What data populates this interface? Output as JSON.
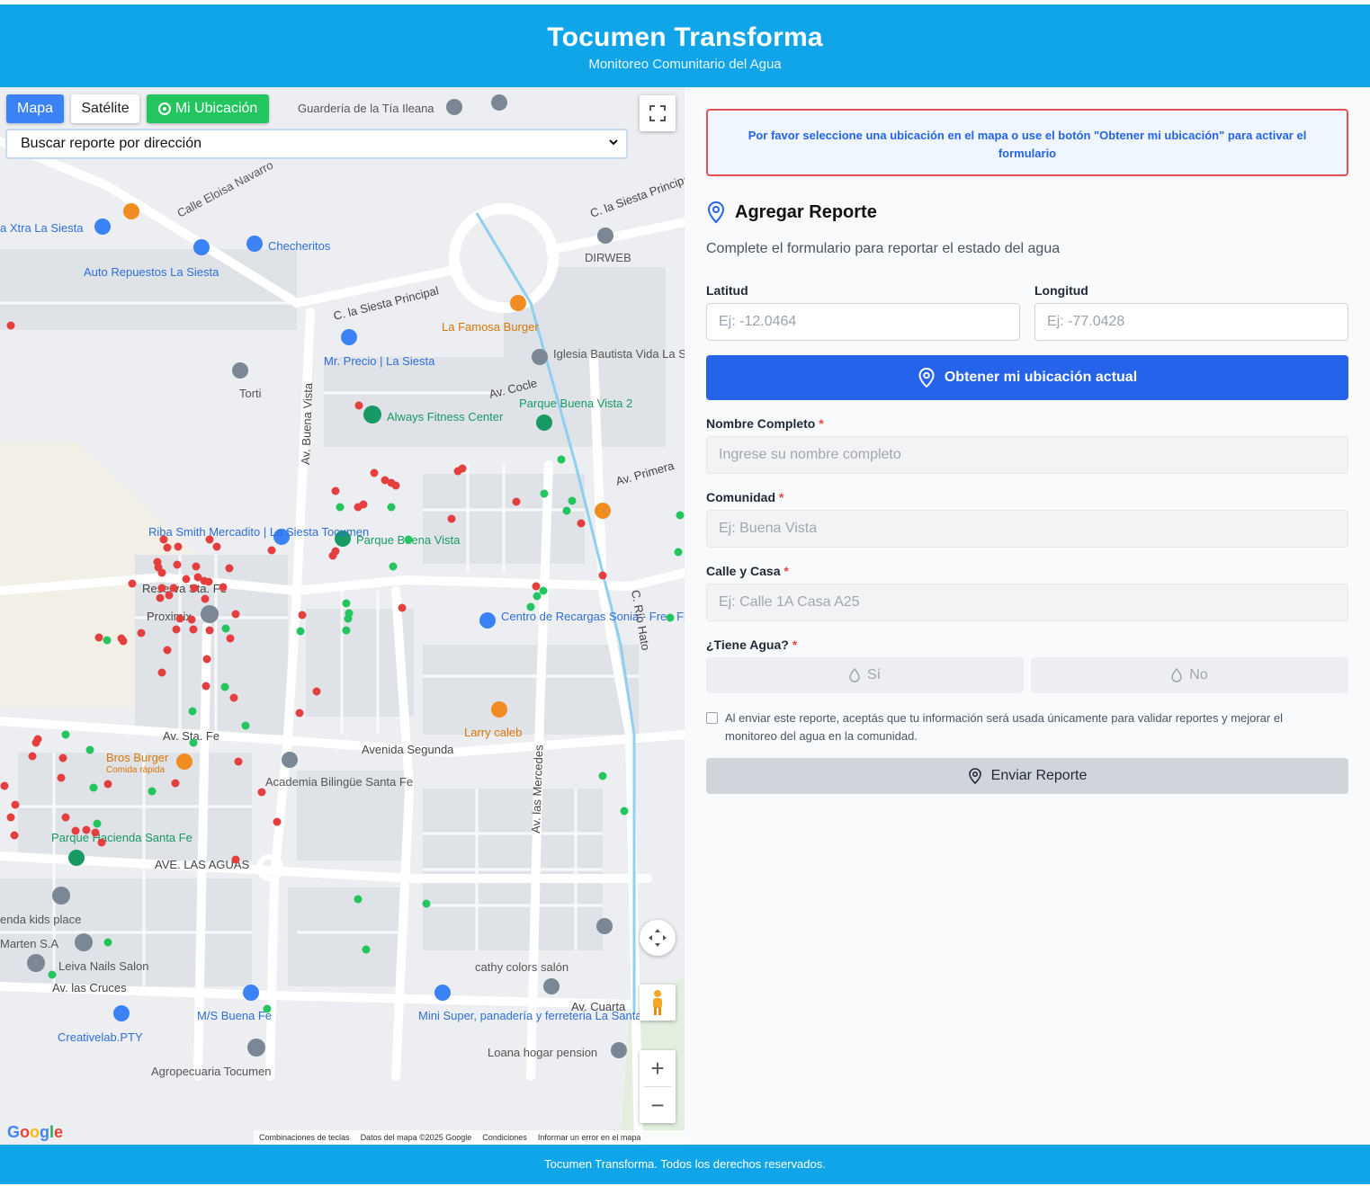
{
  "header": {
    "title": "Tocumen Transforma",
    "subtitle": "Monitoreo Comunitario del Agua"
  },
  "map": {
    "type_buttons": {
      "map": "Mapa",
      "satellite": "Satélite"
    },
    "my_location_button": "Mi Ubicación",
    "search_select": {
      "selected": "Buscar reporte por dirección"
    },
    "labels": {
      "guarderia": "Guardería de la Tía Ileana",
      "eloisa": "Calle Eloisa Navarro",
      "xtra": "a Xtra La Siesta",
      "checheritos": "Checheritos",
      "auto_repuestos": "Auto Repuestos La Siesta",
      "siesta_principal": "C. la Siesta Principal",
      "siesta_principal_2": "C. la Siesta Principal",
      "la_famosa": "La Famosa Burger",
      "dirweb": "DIRWEB",
      "iglesia": "Iglesia Bautista Vida La Siesta",
      "mr_precio": "Mr. Precio | La Siesta",
      "torti": "Torti",
      "always_fitness": "Always Fitness Center",
      "parque_bv2": "Parque Buena Vista 2",
      "av_cocle": "Av. Cocle",
      "av_primera": "Av. Primera",
      "riba_smith": "Riba Smith Mercadito | La Siesta Tocumen",
      "parque_bv": "Parque Buena Vista",
      "reserva": "Reserva Sta. Fe",
      "proximix": "Proximix",
      "centro_recargas": "Centro de Recargas Sonia - Free Fire",
      "av_sta_fe": "Av. Sta. Fe",
      "avenida_segunda": "Avenida Segunda",
      "larry": "Larry caleb",
      "bros_burger": "Bros Burger",
      "comida_rapida": "Comida rápida",
      "academia": "Academia Bilingüe Santa Fe",
      "parque_hacienda": "Parque Hacienda Santa Fe",
      "ave_las_aguas": "AVE. LAS AGUAS",
      "hacienda_kids": "enda kids place",
      "marten": "Marten S.A",
      "leiva": "Leiva Nails Salon",
      "av_las_cruces": "Av. las Cruces",
      "ms_buena_fe": "M/S Buena Fe",
      "creativelab": "Creativelab.PTY",
      "agropecuaria": "Agropecuaria Tocumen",
      "mini_super": "Mini Super, panadería y ferreteria La Santa Fe",
      "loana": "Loana hogar pension",
      "cathy": "cathy colors salón",
      "av_cuarta": "Av. Cuarta",
      "av_mercedes": "Av. las Mercedes",
      "av_buena_vista": "Av. Buena Vista",
      "c_rio_hato": "C. Río Hato"
    },
    "attribution": {
      "shortcuts": "Combinaciones de teclas",
      "data": "Datos del mapa ©2025 Google",
      "terms": "Condiciones",
      "report": "Informar un error en el mapa"
    },
    "report_points": {
      "red_color": "#e53e3e",
      "green_color": "#22c55e"
    }
  },
  "form": {
    "alert": "Por favor seleccione una ubicación en el mapa o use el botón \"Obtener mi ubicación\" para activar el formulario",
    "title": "Agregar Reporte",
    "description": "Complete el formulario para reportar el estado del agua",
    "latitude": {
      "label": "Latitud",
      "placeholder": "Ej: -12.0464"
    },
    "longitude": {
      "label": "Longitud",
      "placeholder": "Ej: -77.0428"
    },
    "get_location_button": "Obtener mi ubicación actual",
    "name": {
      "label": "Nombre Completo",
      "placeholder": "Ingrese su nombre completo"
    },
    "community": {
      "label": "Comunidad",
      "placeholder": "Ej: Buena Vista"
    },
    "street": {
      "label": "Calle y Casa",
      "placeholder": "Ej: Calle 1A Casa A25"
    },
    "has_water": {
      "label": "¿Tiene Agua?",
      "yes": "Sí",
      "no": "No"
    },
    "required_mark": "*",
    "consent": "Al enviar este reporte, aceptás que tu información será usada únicamente para validar reportes y mejorar el monitoreo del agua en la comunidad.",
    "submit_button": "Enviar Reporte"
  },
  "footer": {
    "text": "Tocumen Transforma. Todos los derechos reservados."
  },
  "colors": {
    "brand": "#10a5e8",
    "primary": "#2563eb",
    "alert_border": "#e05252"
  }
}
